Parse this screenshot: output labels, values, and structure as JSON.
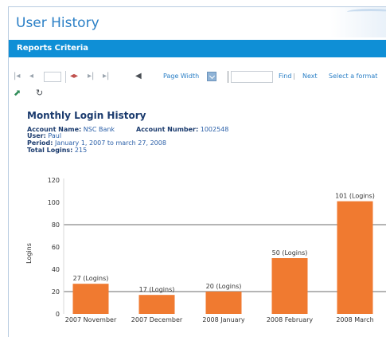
{
  "app": {
    "title": "User History",
    "section_label": "Reports Criteria"
  },
  "toolbar": {
    "page_value": "",
    "page_width_label": "Page Width",
    "find_value": "",
    "find_label": "Find",
    "separator": "|",
    "next_label": "Next",
    "format_label": "Select a format",
    "icons": [
      "first-page-icon",
      "previous-page-icon",
      "next-page-icon",
      "last-page-icon",
      "back-icon",
      "zoom-dropdown-icon",
      "export-icon",
      "refresh-icon"
    ]
  },
  "report": {
    "title": "Monthly Login History",
    "account_name_label": "Account Name:",
    "account_name": "NSC Bank",
    "account_number_label": "Account Number:",
    "account_number": "1002548",
    "user_label": "User:",
    "user": "Paul",
    "period_label": "Period:",
    "period": "January 1, 2007 to march 27, 2008",
    "total_logins_label": "Total Logins:",
    "total_logins": "215"
  },
  "colors": {
    "accent_blue": "#0f8fd6",
    "title_blue": "#2a7fc6",
    "bar_orange": "#f07a30"
  },
  "chart_data": {
    "type": "bar",
    "categories": [
      "2007 November",
      "2007 December",
      "2008 January",
      "2008 February",
      "2008 March"
    ],
    "values": [
      27,
      17,
      20,
      50,
      101
    ],
    "data_labels": [
      "27 (Logins)",
      "17 (Logins)",
      "20 (Logins)",
      "50 (Logins)",
      "101 (Logins)"
    ],
    "ylabel": "Logins",
    "ylim": [
      0,
      120
    ],
    "yticks": [
      0,
      20,
      40,
      60,
      80,
      100,
      120
    ],
    "grid_lines": [
      20,
      80
    ],
    "bar_color": "#f07a30"
  }
}
